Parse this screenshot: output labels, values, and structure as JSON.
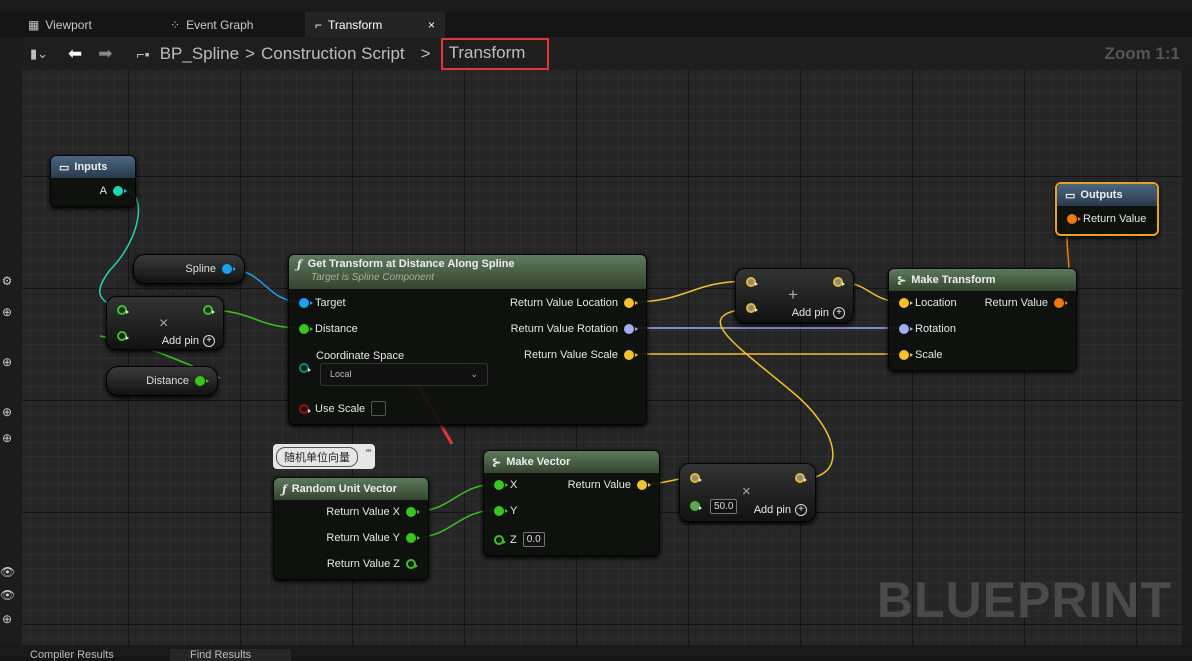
{
  "tabs": [
    {
      "label": "Viewport",
      "icon": "viewport-icon"
    },
    {
      "label": "Event Graph",
      "icon": "event-graph-icon"
    },
    {
      "label": "Transform",
      "icon": "function-icon",
      "active": true,
      "close": "×"
    }
  ],
  "breadcrumb": {
    "items": [
      "BP_Spline",
      "Construction Script",
      "Transform"
    ],
    "separator": ">",
    "zoom": "Zoom 1:1",
    "highlight_color": "#e0363a"
  },
  "nodes": {
    "inputs": {
      "title": "Inputs",
      "pin": "A"
    },
    "spline": {
      "label": "Spline"
    },
    "subtract": {
      "symbol": "×",
      "add_pin": "Add pin"
    },
    "distance": {
      "label": "Distance"
    },
    "get_transform": {
      "title": "Get Transform at Distance Along Spline",
      "subtitle": "Target is Spline Component",
      "inputs": [
        "Target",
        "Distance",
        "Coordinate Space",
        "Use Scale"
      ],
      "coordinate_space_value": "Local",
      "outputs": [
        "Return Value Location",
        "Return Value Rotation",
        "Return Value Scale"
      ],
      "use_scale": false
    },
    "add": {
      "symbol": "+",
      "add_pin": "Add pin"
    },
    "make_transform": {
      "title": "Make Transform",
      "inputs": [
        "Location",
        "Rotation",
        "Scale"
      ],
      "output": "Return Value"
    },
    "outputs": {
      "title": "Outputs",
      "pin": "Return Value"
    },
    "comment": {
      "text": "随机单位向量"
    },
    "random_unit_vector": {
      "title": "Random Unit Vector",
      "outputs": [
        "Return Value X",
        "Return Value Y",
        "Return Value Z"
      ]
    },
    "make_vector": {
      "title": "Make Vector",
      "inputs": [
        "X",
        "Y",
        "Z"
      ],
      "z_value": "0.0",
      "output": "Return Value"
    },
    "multiply": {
      "symbol": "×",
      "value": "50.0",
      "add_pin": "Add pin"
    }
  },
  "watermark": "BLUEPRINT",
  "bottom_tabs": [
    "Compiler Results",
    "Find Results"
  ],
  "colors": {
    "vector": "#f2c12e",
    "rotator": "#a0aef2",
    "float": "#39c51c",
    "object": "#1aa3f0",
    "transform": "#f07a10",
    "enum": "#0b6b5f",
    "bool": "#8a0f0f",
    "exec_wire_int": "#1ed3b0"
  }
}
